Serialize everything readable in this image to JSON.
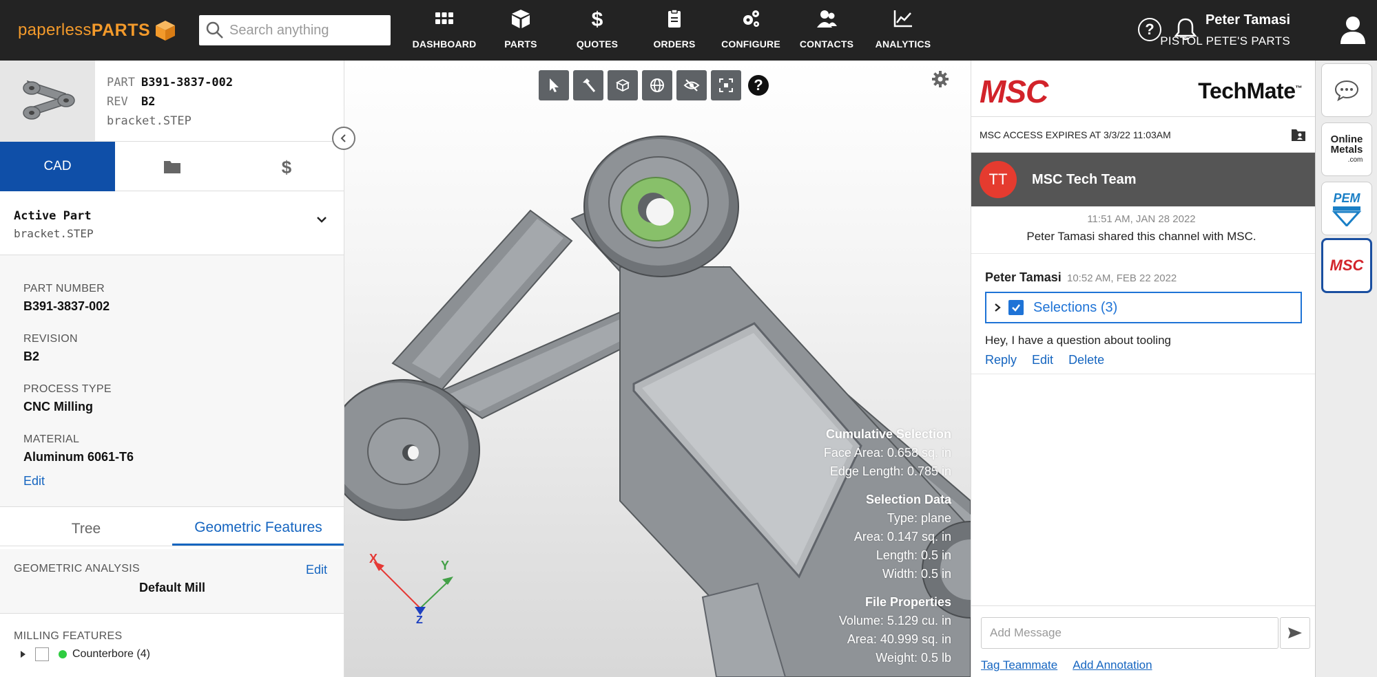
{
  "brand": {
    "logo_part1": "paperless",
    "logo_part2": "PARTS",
    "accent": "#f39a2b"
  },
  "search": {
    "placeholder": "Search anything"
  },
  "nav": {
    "items": [
      {
        "label": "DASHBOARD",
        "icon": "grid-icon"
      },
      {
        "label": "PARTS",
        "icon": "cube-icon"
      },
      {
        "label": "QUOTES",
        "icon": "dollar-icon"
      },
      {
        "label": "ORDERS",
        "icon": "clipboard-icon"
      },
      {
        "label": "CONFIGURE",
        "icon": "gears-icon"
      },
      {
        "label": "CONTACTS",
        "icon": "people-icon"
      },
      {
        "label": "ANALYTICS",
        "icon": "chart-icon"
      }
    ]
  },
  "header": {
    "help_label": "?",
    "user_name": "Peter Tamasi",
    "company": "PISTOL PETE'S PARTS"
  },
  "part": {
    "part_key": "PART",
    "part_value": "B391-3837-002",
    "rev_key": "REV",
    "rev_value": "B2",
    "filename": "bracket.STEP"
  },
  "left_tabs": {
    "cad": "CAD",
    "files_icon": "folder-icon",
    "pricing_icon": "dollar-icon"
  },
  "active_part": {
    "title": "Active Part",
    "file": "bracket.STEP"
  },
  "properties": {
    "part_number_label": "PART NUMBER",
    "part_number": "B391-3837-002",
    "revision_label": "REVISION",
    "revision": "B2",
    "process_label": "PROCESS TYPE",
    "process": "CNC Milling",
    "material_label": "MATERIAL",
    "material": "Aluminum 6061-T6",
    "edit": "Edit"
  },
  "tree_tabs": {
    "tree": "Tree",
    "geometric": "Geometric Features"
  },
  "geometric": {
    "label": "GEOMETRIC ANALYSIS",
    "edit": "Edit",
    "value": "Default Mill"
  },
  "milling": {
    "label": "MILLING FEATURES",
    "feature": "Counterbore (4)",
    "feature_color": "#2ecc40"
  },
  "viewer": {
    "help": "?",
    "cumulative_title": "Cumulative Selection",
    "face_area": "Face Area: 0.658 sq. in",
    "edge_length": "Edge Length: 0.785 in",
    "selection_title": "Selection Data",
    "sel_type": "Type: plane",
    "sel_area": "Area: 0.147 sq. in",
    "sel_length": "Length: 0.5 in",
    "sel_width": "Width: 0.5 in",
    "file_title": "File Properties",
    "volume": "Volume: 5.129 cu. in",
    "file_area": "Area: 40.999 sq. in",
    "weight": "Weight: 0.5 lb",
    "axis_x": "X",
    "axis_y": "Y",
    "axis_z": "Z"
  },
  "chat": {
    "brand_left": "MSC",
    "brand_right": "TechMate",
    "trademark": "™",
    "access_text": "MSC ACCESS EXPIRES AT 3/3/22 11:03AM",
    "team_initials": "TT",
    "team_name": "MSC Tech Team",
    "system_time": "11:51 AM, JAN 28 2022",
    "system_msg": "Peter Tamasi shared this channel with MSC.",
    "message": {
      "author": "Peter Tamasi",
      "time": "10:52 AM, FEB 22 2022",
      "selections": "Selections (3)",
      "body": "Hey, I have a question about tooling",
      "reply": "Reply",
      "edit": "Edit",
      "delete": "Delete"
    },
    "composer_placeholder": "Add Message",
    "tag_teammate": "Tag Teammate",
    "add_annotation": "Add Annotation"
  },
  "rail": {
    "online_metals_line1": "Online",
    "online_metals_line2": "Metals",
    "online_metals_com": ".com",
    "pem": "PEM",
    "msc": "MSC"
  }
}
